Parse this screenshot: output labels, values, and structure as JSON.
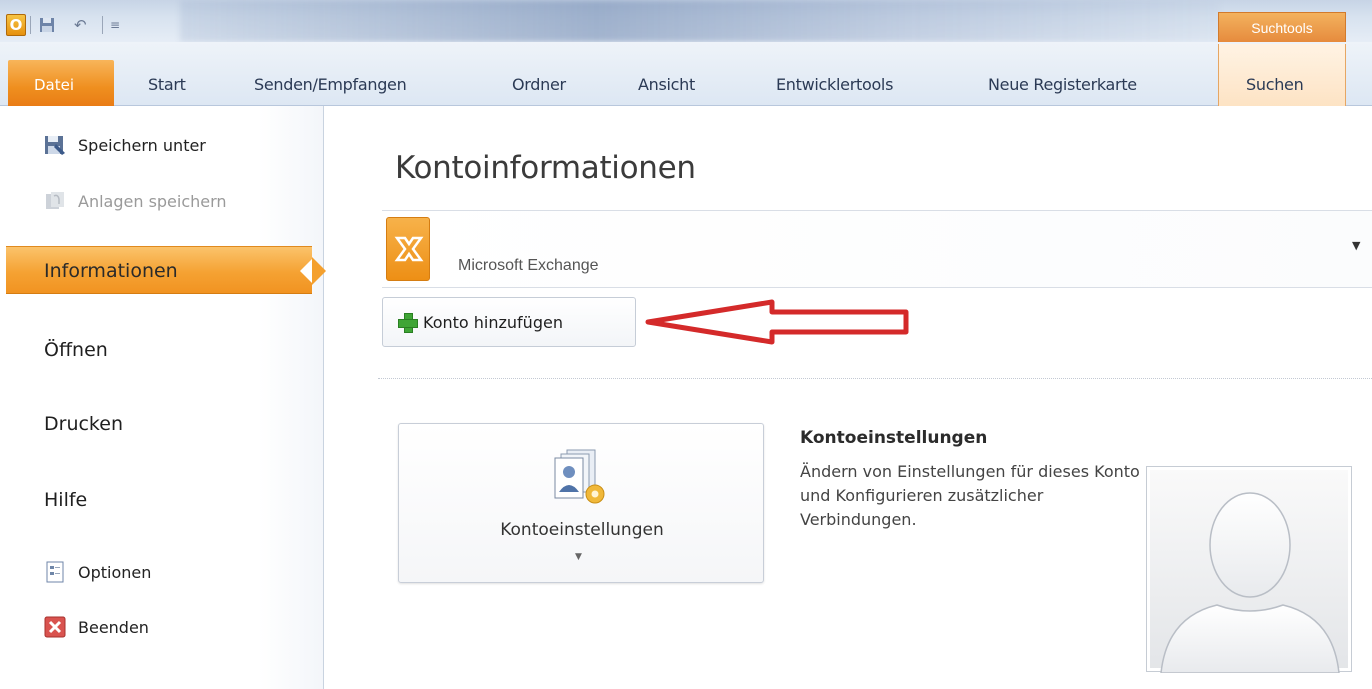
{
  "window": {
    "app_letter": "O",
    "quick_access_icons": [
      "save-icon",
      "undo-icon",
      "customize-icon"
    ],
    "contextual_group": "Suchtools"
  },
  "ribbon": {
    "tabs": [
      "Datei",
      "Start",
      "Senden/Empfangen",
      "Ordner",
      "Ansicht",
      "Entwicklertools",
      "Neue Registerkarte",
      "Suchen"
    ],
    "active_tab": "Datei",
    "file_tab_color": "#ef8f1f"
  },
  "backstage": {
    "commands_top": [
      {
        "label": "Speichern unter",
        "icon": "save-as-icon",
        "enabled": true
      },
      {
        "label": "Anlagen speichern",
        "icon": "save-attachments-icon",
        "enabled": false
      }
    ],
    "nav": [
      "Informationen",
      "Öffnen",
      "Drucken",
      "Hilfe"
    ],
    "active_nav": "Informationen",
    "commands_bottom": [
      {
        "label": "Optionen",
        "icon": "options-icon"
      },
      {
        "label": "Beenden",
        "icon": "exit-icon"
      }
    ],
    "accent_color": "#f5a233"
  },
  "main": {
    "title": "Kontoinformationen",
    "account": {
      "name": "Microsoft Exchange",
      "icon": "exchange-icon"
    },
    "add_account_label": "Konto hinzufügen",
    "settings_button_label": "Kontoeinstellungen",
    "settings_heading": "Kontoeinstellungen",
    "settings_description": "Ändern von Einstellungen für dieses Konto und Konfigurieren zusätzlicher Verbindungen.",
    "annotation_color": "#d42a2a"
  }
}
